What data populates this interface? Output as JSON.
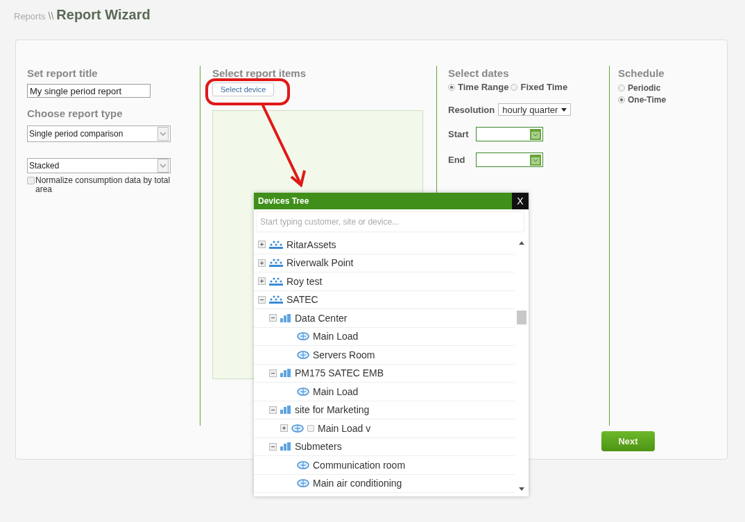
{
  "breadcrumb": {
    "parent": "Reports",
    "separator": "\\\\",
    "current": "Report Wizard"
  },
  "report_title": {
    "heading": "Set report title",
    "value": "My single period report"
  },
  "report_type": {
    "heading": "Choose report type",
    "type_value": "Single period comparison",
    "style_value": "Stacked",
    "normalize": {
      "label": "Normalize consumption data by total area",
      "checked": false
    }
  },
  "report_items": {
    "heading": "Select report items",
    "button": "Select device"
  },
  "dates": {
    "heading": "Select dates",
    "modes": [
      {
        "label": "Time Range",
        "selected": true
      },
      {
        "label": "Fixed Time",
        "selected": false
      }
    ],
    "resolution_label": "Resolution",
    "resolution_value": "hourly quarter",
    "start_label": "Start",
    "end_label": "End"
  },
  "schedule": {
    "heading": "Schedule",
    "options": [
      {
        "label": "Periodic",
        "selected": false
      },
      {
        "label": "One-Time",
        "selected": true
      }
    ]
  },
  "next_button": "Next",
  "devices_tree": {
    "title": "Devices Tree",
    "close": "X",
    "search_placeholder": "Start typing customer, site or device...",
    "items": [
      {
        "label": "RitarAssets",
        "kind": "customer",
        "expanded": false
      },
      {
        "label": "Riverwalk Point",
        "kind": "customer",
        "expanded": false
      },
      {
        "label": "Roy test",
        "kind": "customer",
        "expanded": false
      },
      {
        "label": "SATEC",
        "kind": "customer",
        "expanded": true,
        "children": [
          {
            "label": "Data Center",
            "kind": "site",
            "expanded": true,
            "children": [
              {
                "label": "Main Load",
                "kind": "device"
              },
              {
                "label": "Servers Room",
                "kind": "device"
              }
            ]
          },
          {
            "label": "PM175 SATEC EMB",
            "kind": "site",
            "expanded": true,
            "children": [
              {
                "label": "Main Load",
                "kind": "device"
              }
            ]
          },
          {
            "label": "site for Marketing",
            "kind": "site",
            "expanded": true,
            "children": [
              {
                "label": "Main Load v",
                "kind": "device",
                "expanded": false,
                "checked": false
              }
            ]
          },
          {
            "label": "Submeters",
            "kind": "site",
            "expanded": true,
            "children": [
              {
                "label": "Communication room",
                "kind": "device"
              },
              {
                "label": "Main air conditioning",
                "kind": "device"
              }
            ]
          }
        ]
      }
    ]
  }
}
